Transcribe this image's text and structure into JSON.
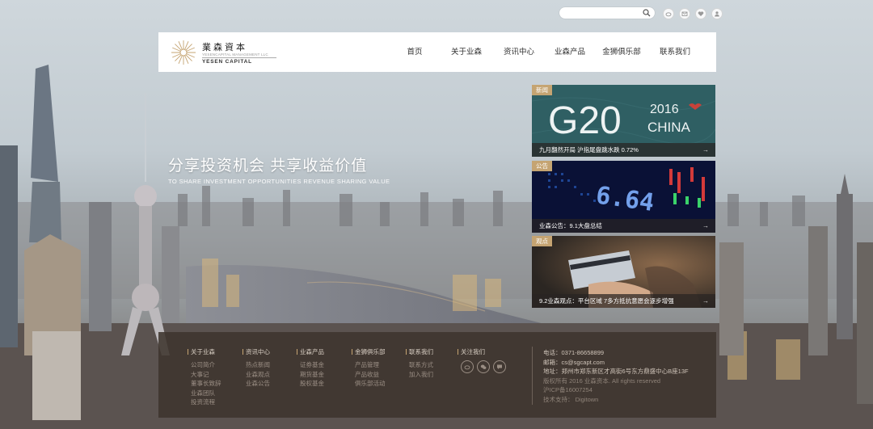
{
  "search": {
    "placeholder": "",
    "icon": "search-icon"
  },
  "top_icons": [
    "weibo-icon",
    "mail-icon",
    "heart-icon",
    "user-icon"
  ],
  "logo": {
    "name_cn": "業森資本",
    "name_small": "YESENCAPITAL MANAGEMENT LLC",
    "name_en": "YESEN CAPITAL"
  },
  "nav": {
    "items": [
      {
        "label": "首页"
      },
      {
        "label": "关于业森"
      },
      {
        "label": "资讯中心"
      },
      {
        "label": "业森产品"
      },
      {
        "label": "金狮俱乐部"
      },
      {
        "label": "联系我们"
      }
    ]
  },
  "hero": {
    "slogan_cn": "分享投资机会 共享收益价值",
    "slogan_en": "TO SHARE INVESTMENT OPPORTUNITIES  REVENUE SHARING VALUE"
  },
  "news": [
    {
      "tag": "新闻",
      "art_main": "G20",
      "art_year": "2016",
      "art_country": "CHINA",
      "caption": "九月翻然开局 沪指尾盘跳水跌 0.72%"
    },
    {
      "tag": "公告",
      "art_digits": "6.64",
      "caption": "业森公告：9.1大盘总结"
    },
    {
      "tag": "观点",
      "caption": "9.2业森观点：平台区域 7多方抵抗意愿会逐步增强"
    }
  ],
  "footer": {
    "columns": [
      {
        "heading": "关于业森",
        "items": [
          "公司简介",
          "大事记",
          "董事长致辞",
          "业森团队",
          "投资流程"
        ]
      },
      {
        "heading": "资讯中心",
        "items": [
          "热点新闻",
          "业森观点",
          "业森公告"
        ]
      },
      {
        "heading": "业森产品",
        "items": [
          "证券基金",
          "期货基金",
          "股权基金"
        ]
      },
      {
        "heading": "金狮俱乐部",
        "items": [
          "产品管理",
          "产品收益",
          "俱乐部活动"
        ]
      },
      {
        "heading": "联系我们",
        "items": [
          "联系方式",
          "加入我们"
        ]
      },
      {
        "heading": "关注我们",
        "items": []
      }
    ],
    "social_icons": [
      "weibo-icon",
      "wechat-icon",
      "chat-icon"
    ],
    "contact": {
      "phone": "电话：0371-86658899",
      "email": "邮箱：cs@sgcapt.com",
      "address": "地址：郑州市郑东新区才高街6号东方鼎盛中心B座13F",
      "copyright": "版权所有 2016 业森资本. All rights reserved",
      "icp": "沪ICP备16007254",
      "support": "技术支持： Digitown"
    }
  },
  "colors": {
    "accent": "#c5a472",
    "footer_bg": "#3e342e",
    "g20_bg": "#2f5f63"
  }
}
